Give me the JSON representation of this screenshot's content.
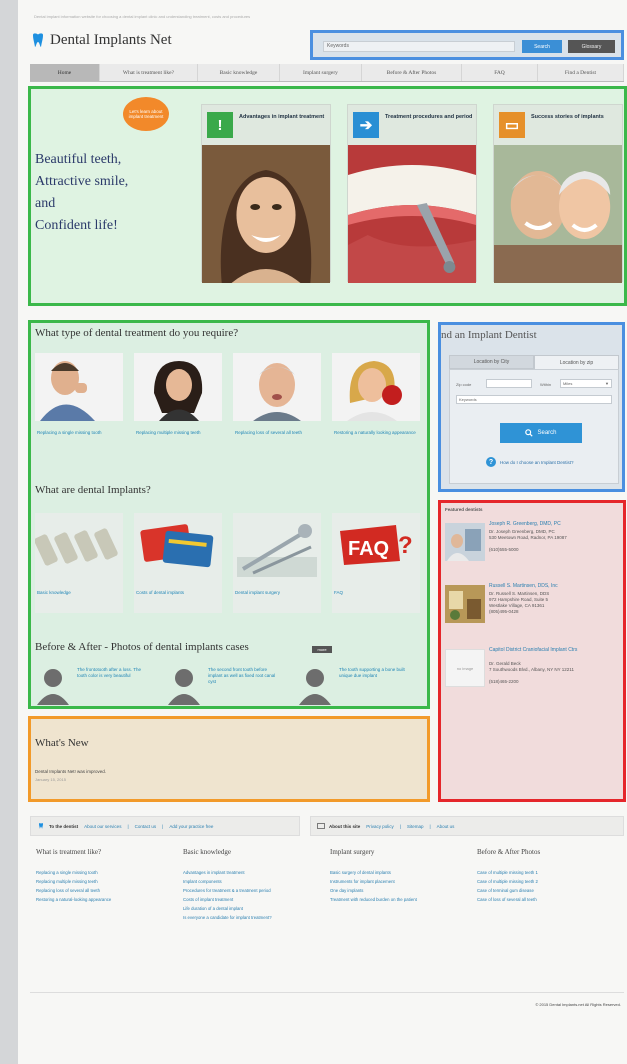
{
  "header": {
    "tagline": "Dental implant information website for choosing a dental implant clinic and understanding treatment, costs and procedures",
    "logo_text": "Dental Implants Net",
    "search_placeholder": "Keywords",
    "search_button": "Search",
    "glossary_button": "Glossary"
  },
  "nav": {
    "items": [
      {
        "label": "Home"
      },
      {
        "label": "What is treatment like?"
      },
      {
        "label": "Basic knowledge"
      },
      {
        "label": "Implant surgery"
      },
      {
        "label": "Before & After Photos"
      },
      {
        "label": "FAQ"
      },
      {
        "label": "Find a Dentist"
      }
    ]
  },
  "hero": {
    "bubble": "Let's learn about implant treatment",
    "tagline": [
      "Beautiful teeth,",
      "Attractive smile,",
      "and",
      "Confident life!"
    ],
    "features": [
      {
        "title": "Advantages in implant treatment",
        "icon": "exclamation-icon",
        "color": "#3aa94a"
      },
      {
        "title": "Treatment procedures and period",
        "icon": "arrow-right-icon",
        "color": "#2a8fd4"
      },
      {
        "title": "Success stories of implants",
        "icon": "book-icon",
        "color": "#e6902a"
      }
    ]
  },
  "treatment": {
    "title": "What type of dental treatment do you require?",
    "items": [
      {
        "label": "Replacing a single missing tooth"
      },
      {
        "label": "Replacing multiple missing teeth"
      },
      {
        "label": "Replacing loss of several all teeth"
      },
      {
        "label": "Restoring a naturally looking appearance"
      }
    ]
  },
  "about": {
    "title": "What are dental Implants?",
    "items": [
      {
        "label": "Basic knowledge"
      },
      {
        "label": "Costs of dental implants"
      },
      {
        "label": "Dental implant surgery"
      },
      {
        "label": "FAQ"
      }
    ]
  },
  "before_after": {
    "title": "Before & After - Photos of dental implants cases",
    "more": "more",
    "cases": [
      {
        "text": "The frontotooth after a loss. The tooth color is very beautiful"
      },
      {
        "text": "The second front tooth before implant as well as fixed root canal cyst"
      },
      {
        "text": "The tooth supporting a bone built unique due implant"
      }
    ]
  },
  "whats_new": {
    "title": "What's New",
    "item": "Dental Implants Net! was improved.",
    "date": "January 15, 2015"
  },
  "find_dentist": {
    "title": "nd an Implant Dentist",
    "tab_city": "Location by City",
    "tab_zip": "Location by zip",
    "zip_label": "Zip code",
    "within_label": "Within",
    "within_value": "Miles",
    "keyword_placeholder": "Keywords",
    "search_button": "Search",
    "help_text": "How do I choose an Implant Dentist?"
  },
  "featured": {
    "title": "Featured dentists",
    "dentists": [
      {
        "name": "Joseph R. Greenberg, DMD, PC",
        "info": [
          "Dr. Joseph Greenberg, DMD, PC",
          "530 Meetown Road, Radnor, PA 19087",
          "(610)555-5000"
        ]
      },
      {
        "name": "Russell S. Martinsen, DDS, Inc",
        "info": [
          "Dr. Russell S. Martinsen, DDS",
          "972 Hampshire Road, Suite 5",
          "Westlake Village, CA 91361",
          "(805)495-0428"
        ]
      },
      {
        "name": "Capitol District Craniofacial Implant Ctrs",
        "info": [
          "Dr. Gerald Beck",
          "7 Southwoods Blvd., Albany, NY NY 12211",
          "(518)465-2200"
        ]
      }
    ],
    "no_image": "no image"
  },
  "footer": {
    "to_dentist": "To the dentist",
    "to_dentist_links": [
      "About our services",
      "Contact us",
      "Add your practice free"
    ],
    "about_site": "About this site",
    "about_links": [
      "Privacy policy",
      "Sitemap",
      "About us"
    ],
    "columns": [
      {
        "title": "What is treatment like?",
        "links": [
          "Replacing a single missing tooth",
          "Replacing multiple missing teeth",
          "Replacing loss of several all teeth",
          "Restoring a natural-looking appearance"
        ]
      },
      {
        "title": "Basic knowledge",
        "links": [
          "Advantages in implant treatment",
          "Implant components",
          "Procedures for treatment & a treatment period",
          "Costs of implant treatment",
          "Life duration of a dental implant",
          "Is everyone a candidate for implant treatment?"
        ]
      },
      {
        "title": "Implant surgery",
        "links": [
          "Basic surgery of dental implants",
          "Instruments for implant placement",
          "One day implants",
          "Treatment with reduced burden on the patient"
        ]
      },
      {
        "title": "Before & After Photos",
        "links": [
          "Case of multiple missing teeth 1",
          "Case of multiple missing teeth 2",
          "Case of terminal gum disease",
          "Case of loss of several all teeth"
        ]
      }
    ],
    "copyright": "© 2015 Dental Implants.net All Rights Reserved."
  }
}
